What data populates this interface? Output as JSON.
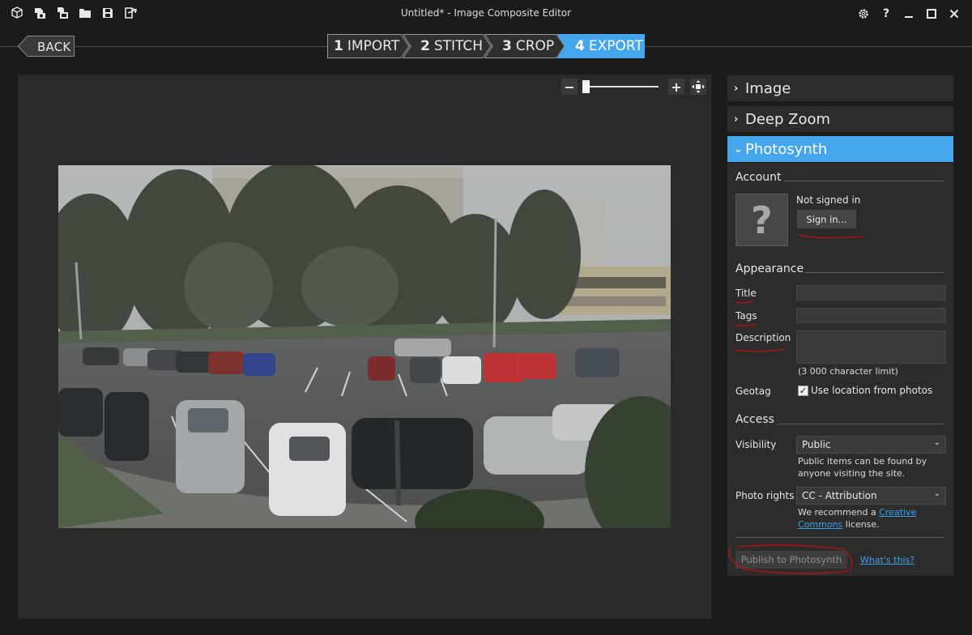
{
  "window": {
    "title": "Untitled* - Image Composite Editor",
    "toolbar_icons": [
      "new-panorama-icon",
      "new-from-video-icon",
      "new-from-images-icon",
      "open-folder-icon",
      "save-icon",
      "export-icon"
    ],
    "settings_icon": "gear-icon",
    "help_label": "?",
    "minimize_icon": "minimize-icon",
    "maximize_icon": "maximize-icon",
    "close_icon": "close-icon"
  },
  "nav": {
    "back_label": "BACK",
    "steps": [
      {
        "num": "1",
        "label": "IMPORT",
        "active": false
      },
      {
        "num": "2",
        "label": "STITCH",
        "active": false
      },
      {
        "num": "3",
        "label": "CROP",
        "active": false
      },
      {
        "num": "4",
        "label": "EXPORT",
        "active": true
      }
    ]
  },
  "zoom": {
    "minus": "−",
    "plus": "+",
    "level": 0.0
  },
  "panel": {
    "sections": [
      {
        "label": "Image",
        "expanded": false
      },
      {
        "label": "Deep Zoom",
        "expanded": false
      },
      {
        "label": "Photosynth",
        "expanded": true
      }
    ],
    "account": {
      "title": "Account",
      "avatar_glyph": "?",
      "status": "Not signed in",
      "sign_in_label": "Sign in..."
    },
    "appearance": {
      "title": "Appearance",
      "title_label": "Title",
      "title_value": "",
      "tags_label": "Tags",
      "tags_value": "",
      "description_label": "Description",
      "description_value": "",
      "char_limit": "(3 000 character limit)",
      "geotag_label": "Geotag",
      "geotag_checked": true,
      "geotag_option": "Use location from photos"
    },
    "access": {
      "title": "Access",
      "visibility_label": "Visibility",
      "visibility_value": "Public",
      "visibility_help_1": "Public items can be found by",
      "visibility_help_2": "anyone visiting the site.",
      "rights_label": "Photo rights",
      "rights_value": "CC - Attribution",
      "rights_help_pre": "We recommend a ",
      "rights_help_link_1": "Creative",
      "rights_help_link_2": "Commons",
      "rights_help_post": " license."
    },
    "publish_label": "Publish to Photosynth",
    "whats_this_label": "What's this?"
  },
  "colors": {
    "accent": "#45a6ee",
    "background": "#1b1b1b",
    "panel": "#2c2c2c",
    "annotation": "#c01010"
  }
}
